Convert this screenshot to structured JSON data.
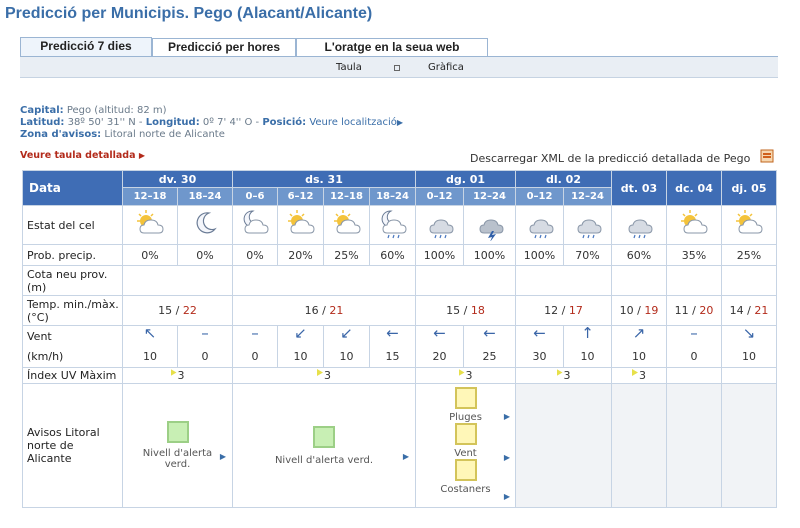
{
  "page_title": "Predicció per Municipis. Pego (Alacant/Alicante)",
  "tabs": [
    {
      "label": "Predicció 7 dies",
      "active": true
    },
    {
      "label": "Predicció per hores",
      "active": false
    },
    {
      "label": "L'oratge en la seua web",
      "active": false
    }
  ],
  "subtabs": {
    "table": "Taula",
    "graphic": "Gràfica"
  },
  "info": {
    "capital_label": "Capital:",
    "capital_value": "Pego (altitud: 82 m)",
    "lat_label": "Latitud:",
    "lat_value": "38º 50' 31'' N -",
    "lon_label": "Longitud:",
    "lon_value": "0º 7' 4'' O -",
    "pos_label": "Posició:",
    "pos_link": "Veure localització",
    "zone_label": "Zona d'avisos:",
    "zone_value": "Litoral norte de Alicante"
  },
  "detail_link": "Veure taula detallada",
  "xml_link": "Descarregar XML de la predicció detallada de Pego",
  "table": {
    "corner": "Data",
    "days": [
      {
        "label": "dv. 30",
        "periods": [
          "12–18",
          "18–24"
        ]
      },
      {
        "label": "ds. 31",
        "periods": [
          "0–6",
          "6–12",
          "12–18",
          "18–24"
        ]
      },
      {
        "label": "dg. 01",
        "periods": [
          "0–12",
          "12–24"
        ]
      },
      {
        "label": "dl. 02",
        "periods": [
          "0–12",
          "12–24"
        ]
      },
      {
        "label": "dt. 03",
        "periods": []
      },
      {
        "label": "dc. 04",
        "periods": []
      },
      {
        "label": "dj. 05",
        "periods": []
      }
    ],
    "row_labels": {
      "sky": "Estat del cel",
      "precip": "Prob. precip.",
      "snow": "Cota neu prov. (m)",
      "temp": "Temp. min./màx. (°C)",
      "wind": "Vent",
      "wind_unit": "(km/h)",
      "uv": "Índex UV Màxim",
      "warn": "Avisos Litoral norte de Alicante"
    },
    "sky_icons": [
      "sun-cloud-icon",
      "moon-icon",
      "moon-cloud-icon",
      "sun-cloud-icon",
      "sun-cloud-icon",
      "moon-cloud-rain-icon",
      "cloud-rain-icon",
      "storm-icon",
      "cloud-rain-icon",
      "cloud-rain-icon",
      "cloud-rain-icon",
      "sun-cloud-icon",
      "sun-cloud-icon"
    ],
    "precip": [
      "0%",
      "0%",
      "0%",
      "20%",
      "25%",
      "60%",
      "100%",
      "100%",
      "100%",
      "70%",
      "60%",
      "35%",
      "25%"
    ],
    "temps": [
      {
        "min": "15",
        "max": "22"
      },
      {
        "min": "16",
        "max": "21"
      },
      {
        "min": "15",
        "max": "18"
      },
      {
        "min": "12",
        "max": "17"
      },
      {
        "min": "10",
        "max": "19"
      },
      {
        "min": "11",
        "max": "20"
      },
      {
        "min": "14",
        "max": "21"
      }
    ],
    "wind_dirs": [
      "↖",
      "–",
      "–",
      "↙",
      "↙",
      "←",
      "←",
      "←",
      "←",
      "↑",
      "↗",
      "–",
      "↘"
    ],
    "wind_speeds": [
      "10",
      "0",
      "0",
      "10",
      "10",
      "15",
      "20",
      "25",
      "30",
      "10",
      "10",
      "0",
      "10"
    ],
    "uv": [
      "3",
      "3",
      "3",
      "3",
      "3"
    ],
    "warnings": {
      "d1": "Nivell d'alerta verd.",
      "d2": "Nivell d'alerta verd.",
      "d3": [
        "Pluges",
        "Vent",
        "Costaners"
      ]
    }
  },
  "colors": {
    "header": "#3f6db5",
    "subheader": "#6f97cc",
    "tmax": "#b32b1b",
    "accent": "#3a6ea8"
  }
}
